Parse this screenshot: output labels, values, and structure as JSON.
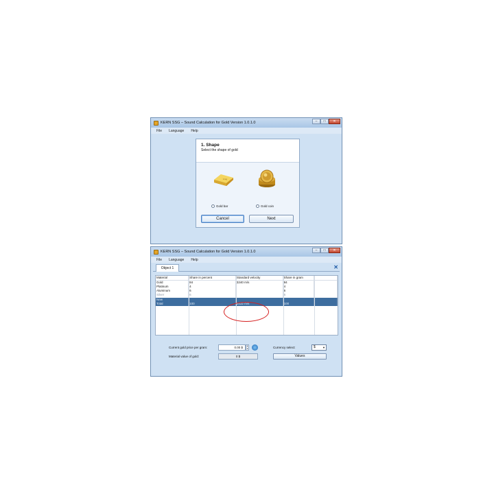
{
  "window1": {
    "title": "KERN SSG – Sound Calculation for Gold    Version 1.0.1.0",
    "controls": {
      "minimize": "–",
      "maximize": "□",
      "close": "✕"
    },
    "menu": [
      "File",
      "Language",
      "Help"
    ],
    "dialog": {
      "title": "1. Shape",
      "subtitle": "Select the shape of gold",
      "options": [
        "Gold bar",
        "Gold coin"
      ],
      "cancel_label": "Cancel",
      "next_label": "Next"
    }
  },
  "window2": {
    "title": "KERN SSG – Sound Calculation for Gold    Version 1.0.1.0",
    "controls": {
      "minimize": "–",
      "maximize": "□",
      "close": "✕"
    },
    "menu": [
      "File",
      "Language",
      "Help"
    ],
    "tab_label": "Object 1",
    "tab_close": "✕",
    "table": {
      "headers": [
        "Material",
        "Share in percent",
        "Standard velocity",
        "Share in gram",
        ""
      ],
      "rows": [
        [
          "Gold",
          "84",
          "3240 m/s",
          "84",
          ""
        ],
        [
          "Platinum",
          "4",
          "",
          "4",
          ""
        ],
        [
          "Aluminum",
          "6",
          "",
          "6",
          ""
        ],
        [
          "Silver",
          "6",
          "",
          "6",
          ""
        ],
        [
          "New",
          "",
          "",
          "",
          ""
        ],
        [
          "Total",
          "100",
          "3432 m/s",
          "100",
          ""
        ]
      ]
    },
    "bottom": {
      "price_label": "Current gold price per gram:",
      "price_value": "0.00 $",
      "currency_label": "Currency select:",
      "currency_value": "$",
      "material_label": "Material value of gold:",
      "material_value": "0 $",
      "values_button": "Values"
    }
  },
  "colors": {
    "selection": "#3d6d9f",
    "highlight_circle": "#d51e1e",
    "window_bg": "#cfe1f3"
  }
}
